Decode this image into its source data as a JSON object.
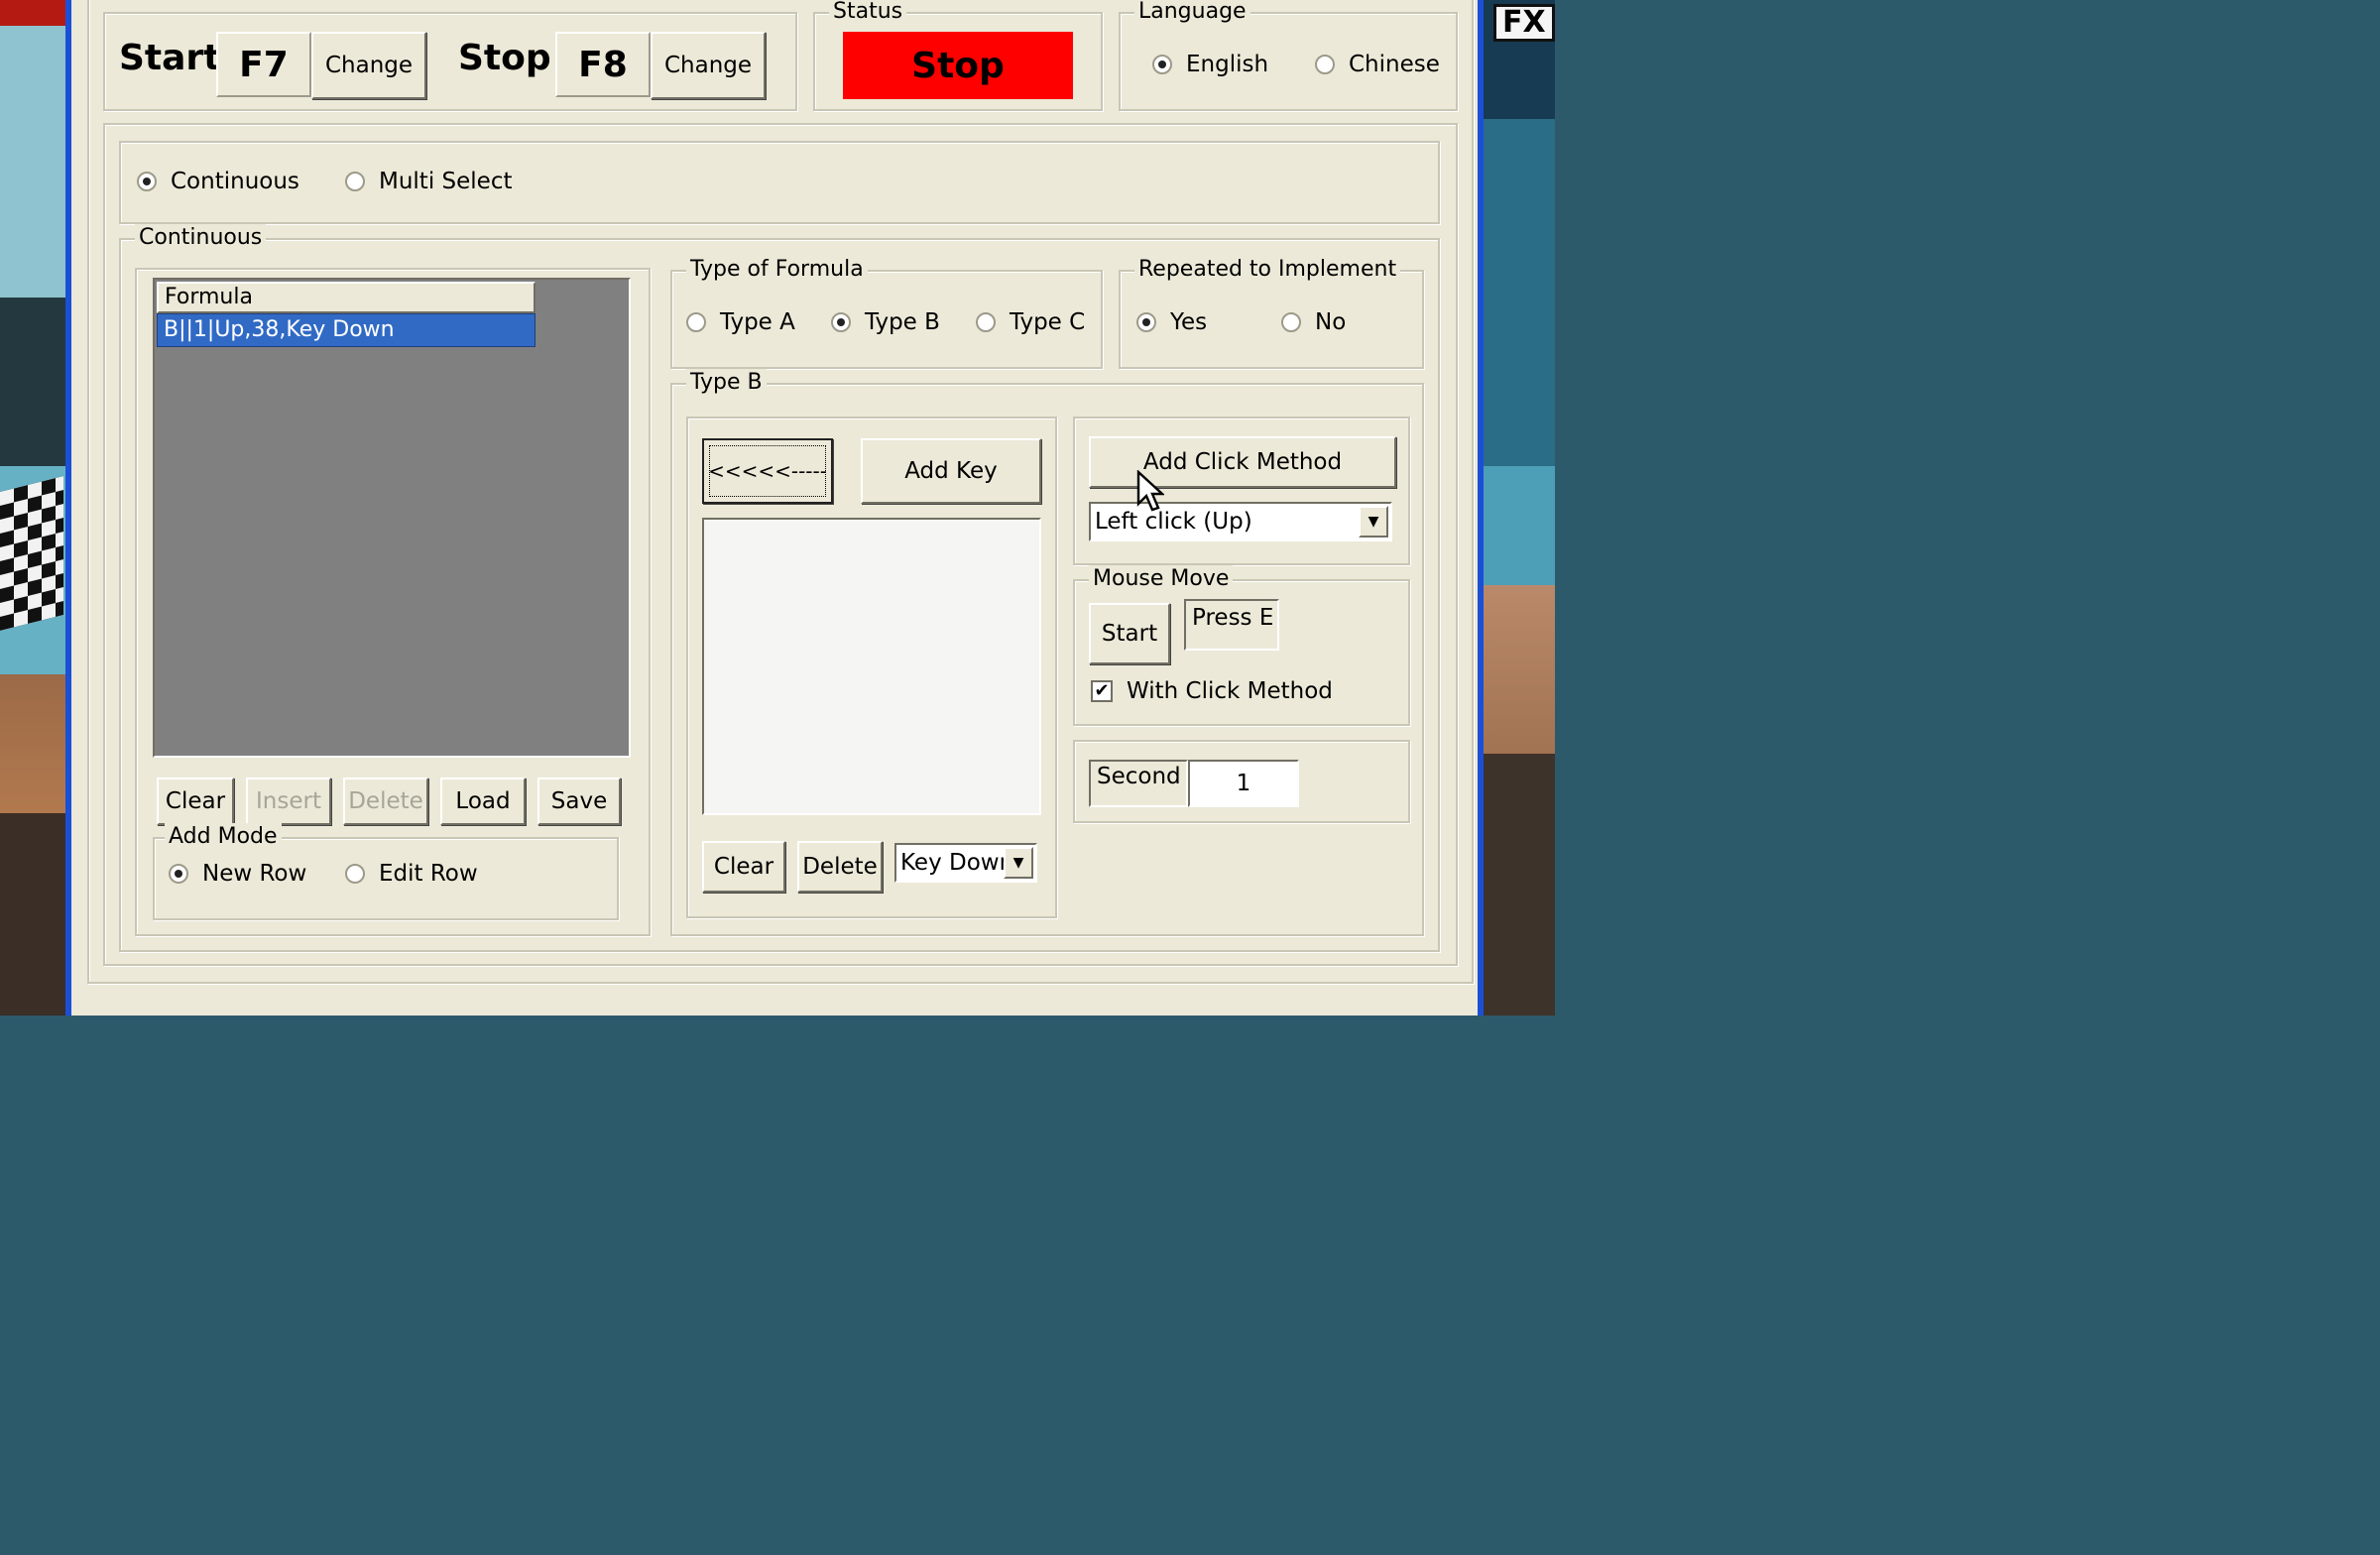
{
  "hotkeys": {
    "start_label": "Start",
    "start_key": "F7",
    "start_change": "Change",
    "stop_label": "Stop",
    "stop_key": "F8",
    "stop_change": "Change"
  },
  "status": {
    "legend": "Status",
    "value": "Stop",
    "color": "#ff0000"
  },
  "language": {
    "legend": "Language",
    "options": [
      "English",
      "Chinese"
    ],
    "selected": "English"
  },
  "mode": {
    "options": [
      "Continuous",
      "Multi Select"
    ],
    "selected": "Continuous"
  },
  "continuous": {
    "legend": "Continuous",
    "list": {
      "header": "Formula",
      "rows": [
        "B||1|Up,38,Key Down"
      ],
      "selected_index": 0
    },
    "buttons": [
      "Clear",
      "Insert",
      "Delete",
      "Load",
      "Save"
    ],
    "add_mode": {
      "legend": "Add Mode",
      "options": [
        "New Row",
        "Edit Row"
      ],
      "selected": "New Row"
    }
  },
  "type_of_formula": {
    "legend": "Type of Formula",
    "options": [
      "Type A",
      "Type B",
      "Type C"
    ],
    "selected": "Type B"
  },
  "repeated": {
    "legend": "Repeated to Implement",
    "options": [
      "Yes",
      "No"
    ],
    "selected": "Yes"
  },
  "type_b": {
    "legend": "Type B",
    "arrow_button": "<<<<<-----",
    "add_key": "Add Key",
    "clear": "Clear",
    "delete": "Delete",
    "key_event": "Key Down",
    "add_click_method": "Add Click Method",
    "click_method": "Left click (Up)",
    "mouse_move": {
      "legend": "Mouse Move",
      "start": "Start",
      "hint": "Press E",
      "with_click_method": "With Click Method",
      "checked": true
    },
    "second_label": "Second",
    "second_value": "1"
  },
  "icons": {
    "dropdown": "chevron-down-icon",
    "check": "checkmark-icon",
    "cursor": "mouse-pointer-icon",
    "fx": "FX"
  },
  "colors": {
    "window_bg": "#ece9d8",
    "selection": "#316ac5",
    "list_bg": "#808080",
    "frame": "#1b4fd6"
  }
}
